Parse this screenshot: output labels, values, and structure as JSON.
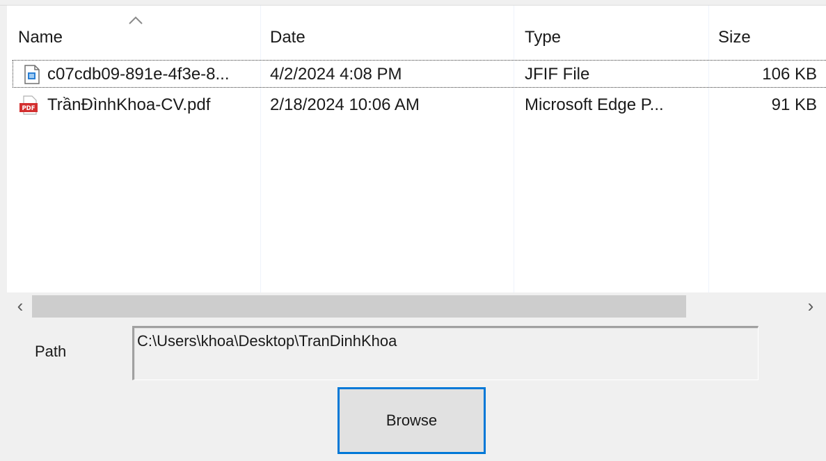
{
  "list": {
    "columns": [
      {
        "label": "Name"
      },
      {
        "label": "Date"
      },
      {
        "label": "Type"
      },
      {
        "label": "Size"
      }
    ],
    "rows": [
      {
        "icon": "image-file-icon",
        "name": "c07cdb09-891e-4f3e-8...",
        "date": "4/2/2024 4:08 PM",
        "type": "JFIF File",
        "size": "106 KB",
        "selected": true
      },
      {
        "icon": "pdf-file-icon",
        "name": "TrầnĐìnhKhoa-CV.pdf",
        "date": "2/18/2024 10:06 AM",
        "type": "Microsoft Edge P...",
        "size": "91 KB",
        "selected": false
      }
    ],
    "sort_indicator": "sort-ascending-icon"
  },
  "scrollbar": {
    "left_arrow": "‹",
    "right_arrow": "›"
  },
  "path": {
    "label": "Path",
    "value": "C:\\Users\\khoa\\Desktop\\TranDinhKhoa"
  },
  "browse": {
    "label": "Browse"
  },
  "colors": {
    "focus_border": "#0078d7",
    "pdf_red": "#d32f2f",
    "image_blue": "#2a7fd4"
  }
}
